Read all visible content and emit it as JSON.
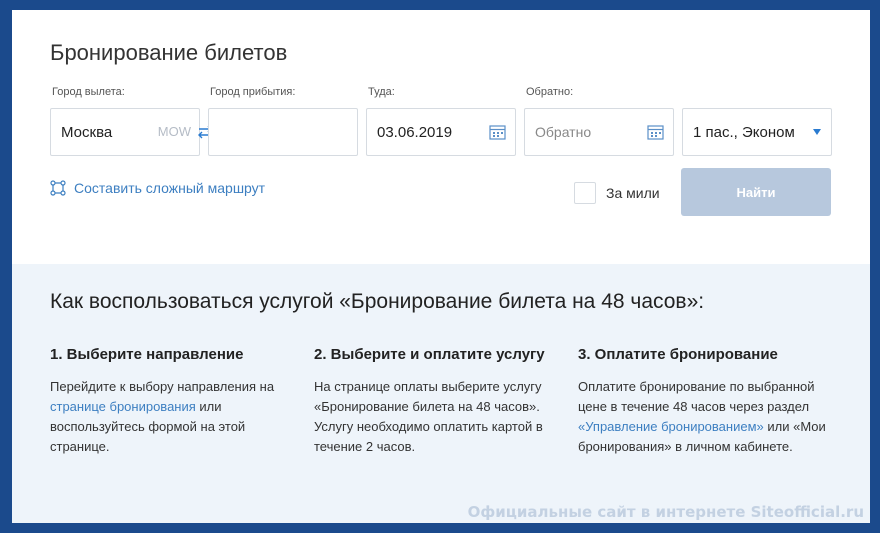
{
  "booking": {
    "title": "Бронирование билетов",
    "from": {
      "label": "Город вылета:",
      "value": "Москва",
      "code": "MOW"
    },
    "to": {
      "label": "Город прибытия:",
      "value": ""
    },
    "depart": {
      "label": "Туда:",
      "value": "03.06.2019"
    },
    "return": {
      "label": "Обратно:",
      "placeholder": "Обратно"
    },
    "passengers": {
      "value": "1 пас., Эконом"
    },
    "complex_route": "Составить сложный маршрут",
    "miles_label": "За мили",
    "find_button": "Найти"
  },
  "howto": {
    "heading": "Как воспользоваться услугой «Бронирование билета на 48 часов»:",
    "steps": [
      {
        "title": "1. Выберите направление",
        "p1": "Перейдите к выбору направления на ",
        "link": "странице бронирования",
        "p2": " или воспользуйтесь формой на этой странице."
      },
      {
        "title": "2. Выберите и оплатите услугу",
        "text": "На странице оплаты выберите услугу «Бронирование билета на 48 часов». Услугу необходимо оплатить картой в течение 2 часов."
      },
      {
        "title": "3. Оплатите бронирование",
        "p1": "Оплатите бронирование по выбранной цене в течение 48 часов через раздел ",
        "link": "«Управление бронированием»",
        "p2": " или «Мои бронирования» в личном кабинете."
      }
    ]
  },
  "watermark": "Официальные сайт в интернете Siteofficial.ru",
  "colors": {
    "link": "#3d7fc1",
    "button_disabled": "#b7c8dd",
    "info_bg": "#eef4fa",
    "frame": "#1b4a8c"
  }
}
